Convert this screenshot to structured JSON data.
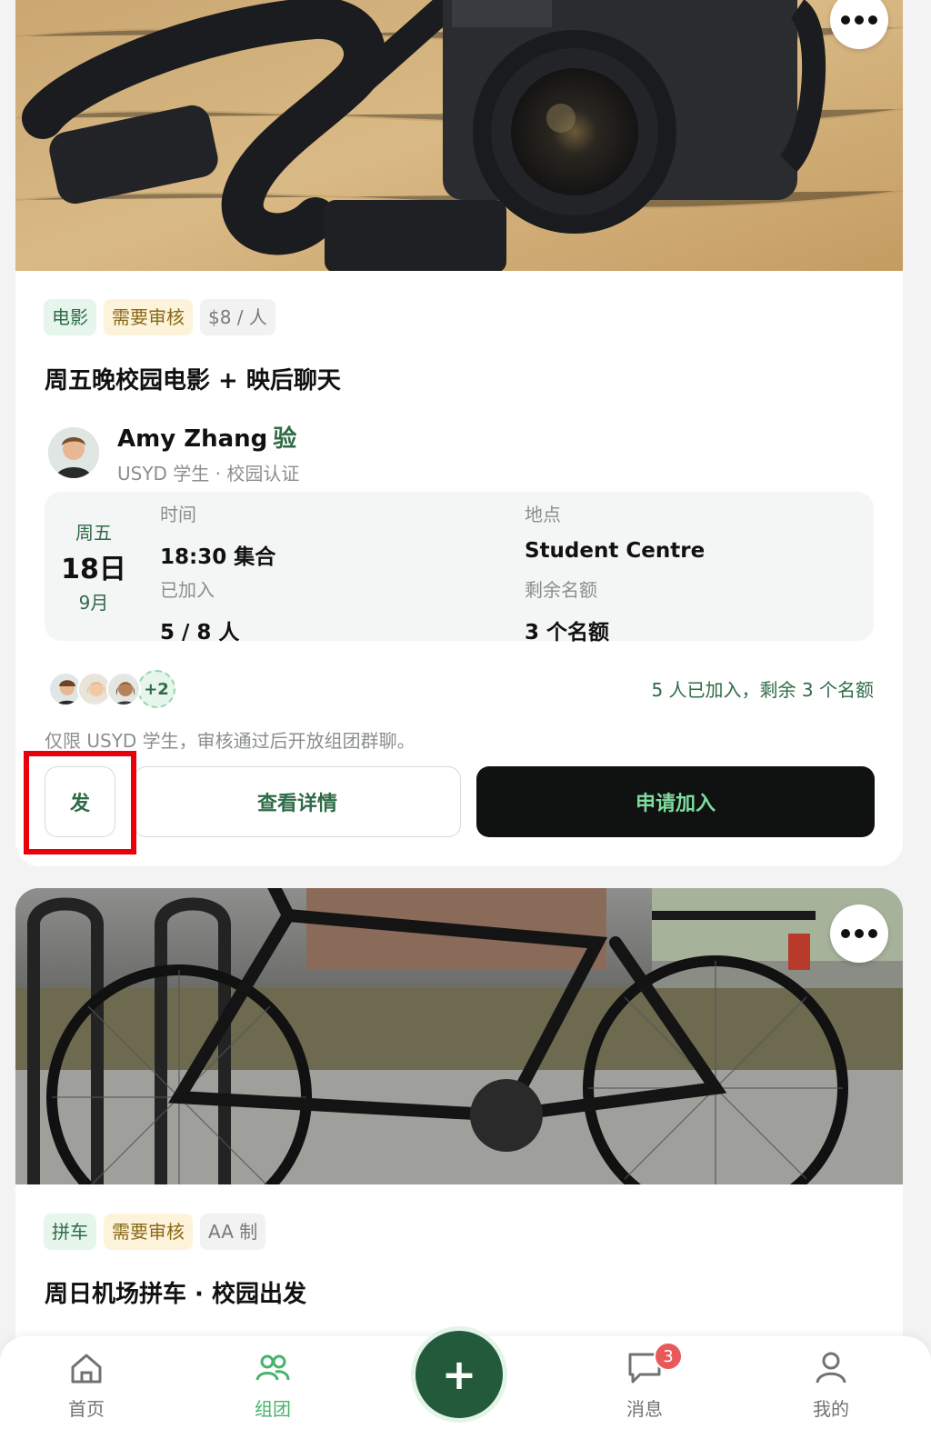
{
  "cards": [
    {
      "image_icon": "camera-photo",
      "tags": [
        {
          "label": "电影",
          "color": "green"
        },
        {
          "label": "需要审核",
          "color": "yellow"
        },
        {
          "label": "$8 / 人",
          "color": "gray"
        }
      ],
      "title": "周五晚校园电影 + 映后聊天",
      "host": {
        "name": "Amy Zhang",
        "verify_badge": "验",
        "subtitle": "USYD 学生 · 校园认证"
      },
      "date": {
        "weekday": "周五",
        "day": "18日",
        "month": "9月"
      },
      "fields": {
        "time_label": "时间",
        "time_value": "18:30 集合",
        "joined_label": "已加入",
        "joined_value": "5 / 8 人",
        "place_label": "地点",
        "place_value": "Student Centre",
        "remaining_label": "剩余名额",
        "remaining_value": "3 个名额"
      },
      "members_more": "+2",
      "members_status": "5 人已加入，剩余 3 个名额",
      "note": "仅限 USYD 学生，审核通过后开放组团群聊。",
      "buttons": {
        "send": "发",
        "detail": "查看详情",
        "join": "申请加入"
      }
    },
    {
      "image_icon": "bicycle-photo",
      "tags": [
        {
          "label": "拼车",
          "color": "green"
        },
        {
          "label": "需要审核",
          "color": "yellow"
        },
        {
          "label": "AA 制",
          "color": "gray"
        }
      ],
      "title": "周日机场拼车 · 校园出发"
    }
  ],
  "tabbar": {
    "home": "首页",
    "groups": "组团",
    "create": "+",
    "messages": "消息",
    "messages_badge": "3",
    "me": "我的"
  },
  "colors": {
    "accent_green": "#2f6b47",
    "active_tab": "#47b36d",
    "fab": "#245a3c",
    "join_button": "#0f1210",
    "badge": "#e85a5a",
    "highlight": "#e8000b"
  }
}
